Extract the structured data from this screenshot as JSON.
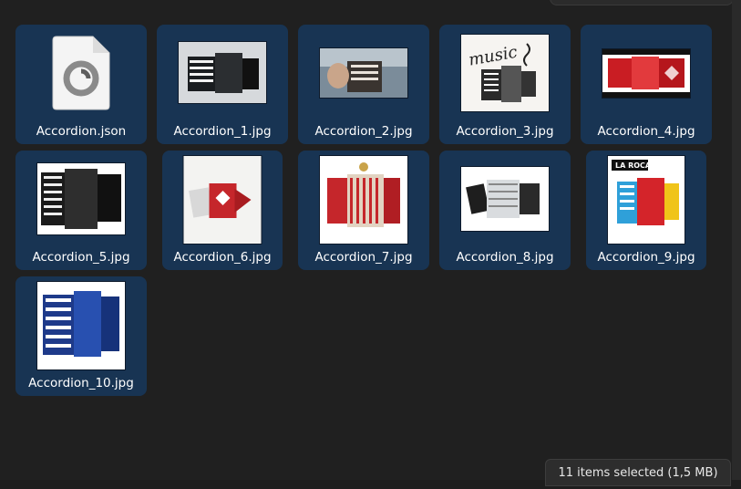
{
  "files": [
    {
      "name": "Accordion.json",
      "kind": "json-file"
    },
    {
      "name": "Accordion_1.jpg",
      "kind": "image"
    },
    {
      "name": "Accordion_2.jpg",
      "kind": "image"
    },
    {
      "name": "Accordion_3.jpg",
      "kind": "image"
    },
    {
      "name": "Accordion_4.jpg",
      "kind": "image"
    },
    {
      "name": "Accordion_5.jpg",
      "kind": "image"
    },
    {
      "name": "Accordion_6.jpg",
      "kind": "image"
    },
    {
      "name": "Accordion_7.jpg",
      "kind": "image"
    },
    {
      "name": "Accordion_8.jpg",
      "kind": "image"
    },
    {
      "name": "Accordion_9.jpg",
      "kind": "image"
    },
    {
      "name": "Accordion_10.jpg",
      "kind": "image"
    }
  ],
  "status": {
    "text": "11 items selected  (1,5 MB)"
  },
  "thumb_text": {
    "music_word": "music",
    "la_roca": "LA ROCA"
  },
  "colors": {
    "selected_tile": "#183453",
    "background": "#202020",
    "status_bg": "#2d2d2d"
  }
}
